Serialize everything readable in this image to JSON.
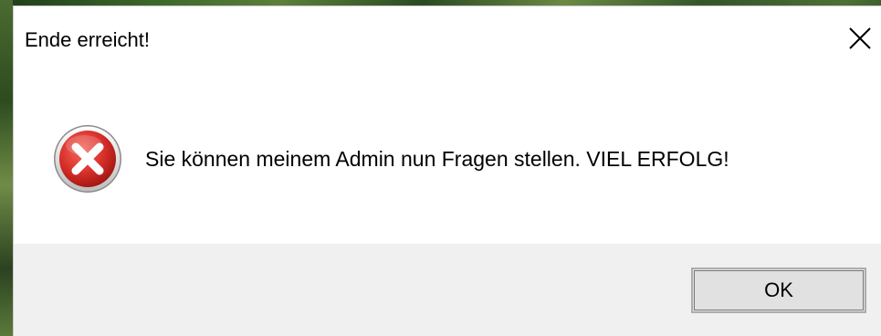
{
  "dialog": {
    "title": "Ende erreicht!",
    "message": "Sie können meinem Admin nun Fragen stellen. VIEL ERFOLG!",
    "ok_label": "OK",
    "icon": "error-icon",
    "close_icon": "close-icon"
  },
  "colors": {
    "dialog_bg": "#ffffff",
    "footer_bg": "#f0f0f0",
    "button_bg": "#e1e1e1",
    "error_red": "#d9312b",
    "text": "#000000"
  }
}
